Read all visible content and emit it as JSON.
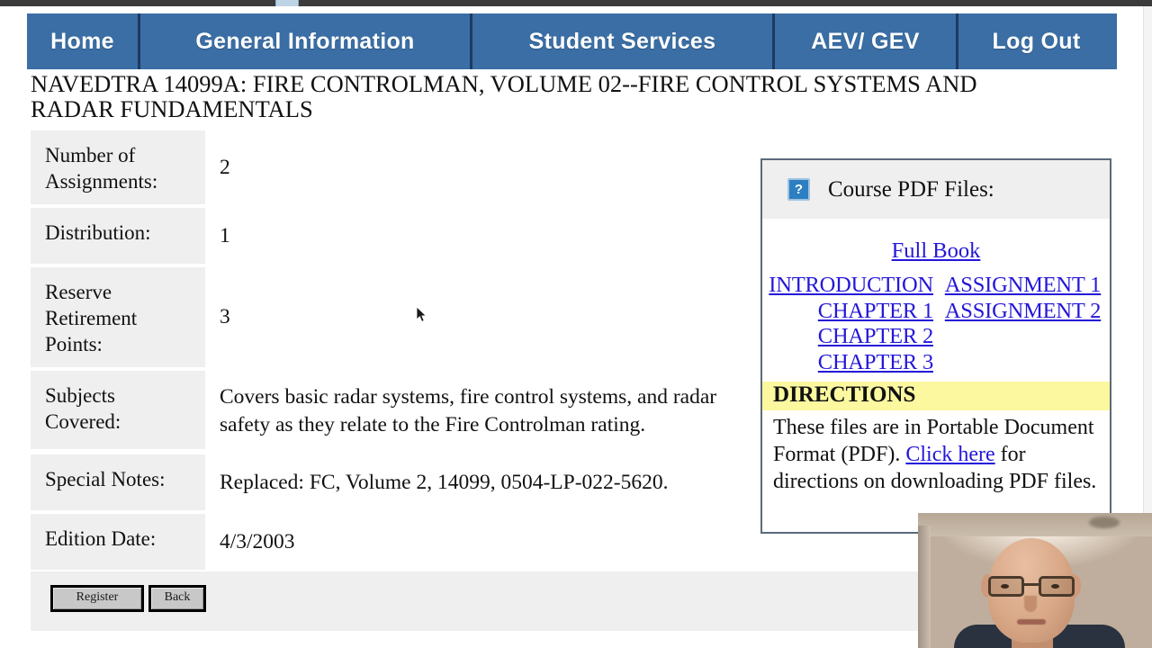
{
  "nav": {
    "items": [
      {
        "label": "Home",
        "name": "nav-item-home"
      },
      {
        "label": "General Information",
        "name": "nav-item-general-information"
      },
      {
        "label": "Student Services",
        "name": "nav-item-student-services"
      },
      {
        "label": "AEV/ GEV",
        "name": "nav-item-aev-gev"
      },
      {
        "label": "Log Out",
        "name": "nav-item-log-out"
      }
    ],
    "accent_color": "#3a6ea5",
    "separator_color": "#1f3a61"
  },
  "course": {
    "title": "NAVEDTRA 14099A: FIRE CONTROLMAN, VOLUME 02--FIRE CONTROL SYSTEMS AND RADAR FUNDAMENTALS",
    "rows": [
      {
        "label": "Number of Assignments:",
        "value": "2"
      },
      {
        "label": "Distribution:",
        "value": "1"
      },
      {
        "label": "Reserve Retirement Points:",
        "value": "3"
      },
      {
        "label": "Subjects Covered:",
        "value": "Covers basic radar systems, fire control systems, and radar safety as they relate to the Fire Controlman rating."
      },
      {
        "label": "Special Notes:",
        "value": "Replaced: FC, Volume 2, 14099, 0504-LP-022-5620."
      },
      {
        "label": "Edition Date:",
        "value": "4/3/2003"
      }
    ]
  },
  "buttons": {
    "register_label": "Register",
    "back_label": "Back"
  },
  "pdf_panel": {
    "icon": "help-question-icon",
    "icon_glyph": "?",
    "header_title": "Course PDF Files:",
    "full_book_label": "Full Book",
    "left_links": [
      "INTRODUCTION",
      "CHAPTER 1",
      "CHAPTER 2",
      "CHAPTER 3"
    ],
    "right_links": [
      "ASSIGNMENT 1",
      "ASSIGNMENT 2"
    ],
    "directions_heading": "DIRECTIONS",
    "directions_line1": "These files are in Portable Document Format (PDF).",
    "directions_link": "Click here",
    "directions_rest": " for directions on downloading PDF files.",
    "highlight_color": "#fbf8a0",
    "link_color": "#2417d8"
  }
}
